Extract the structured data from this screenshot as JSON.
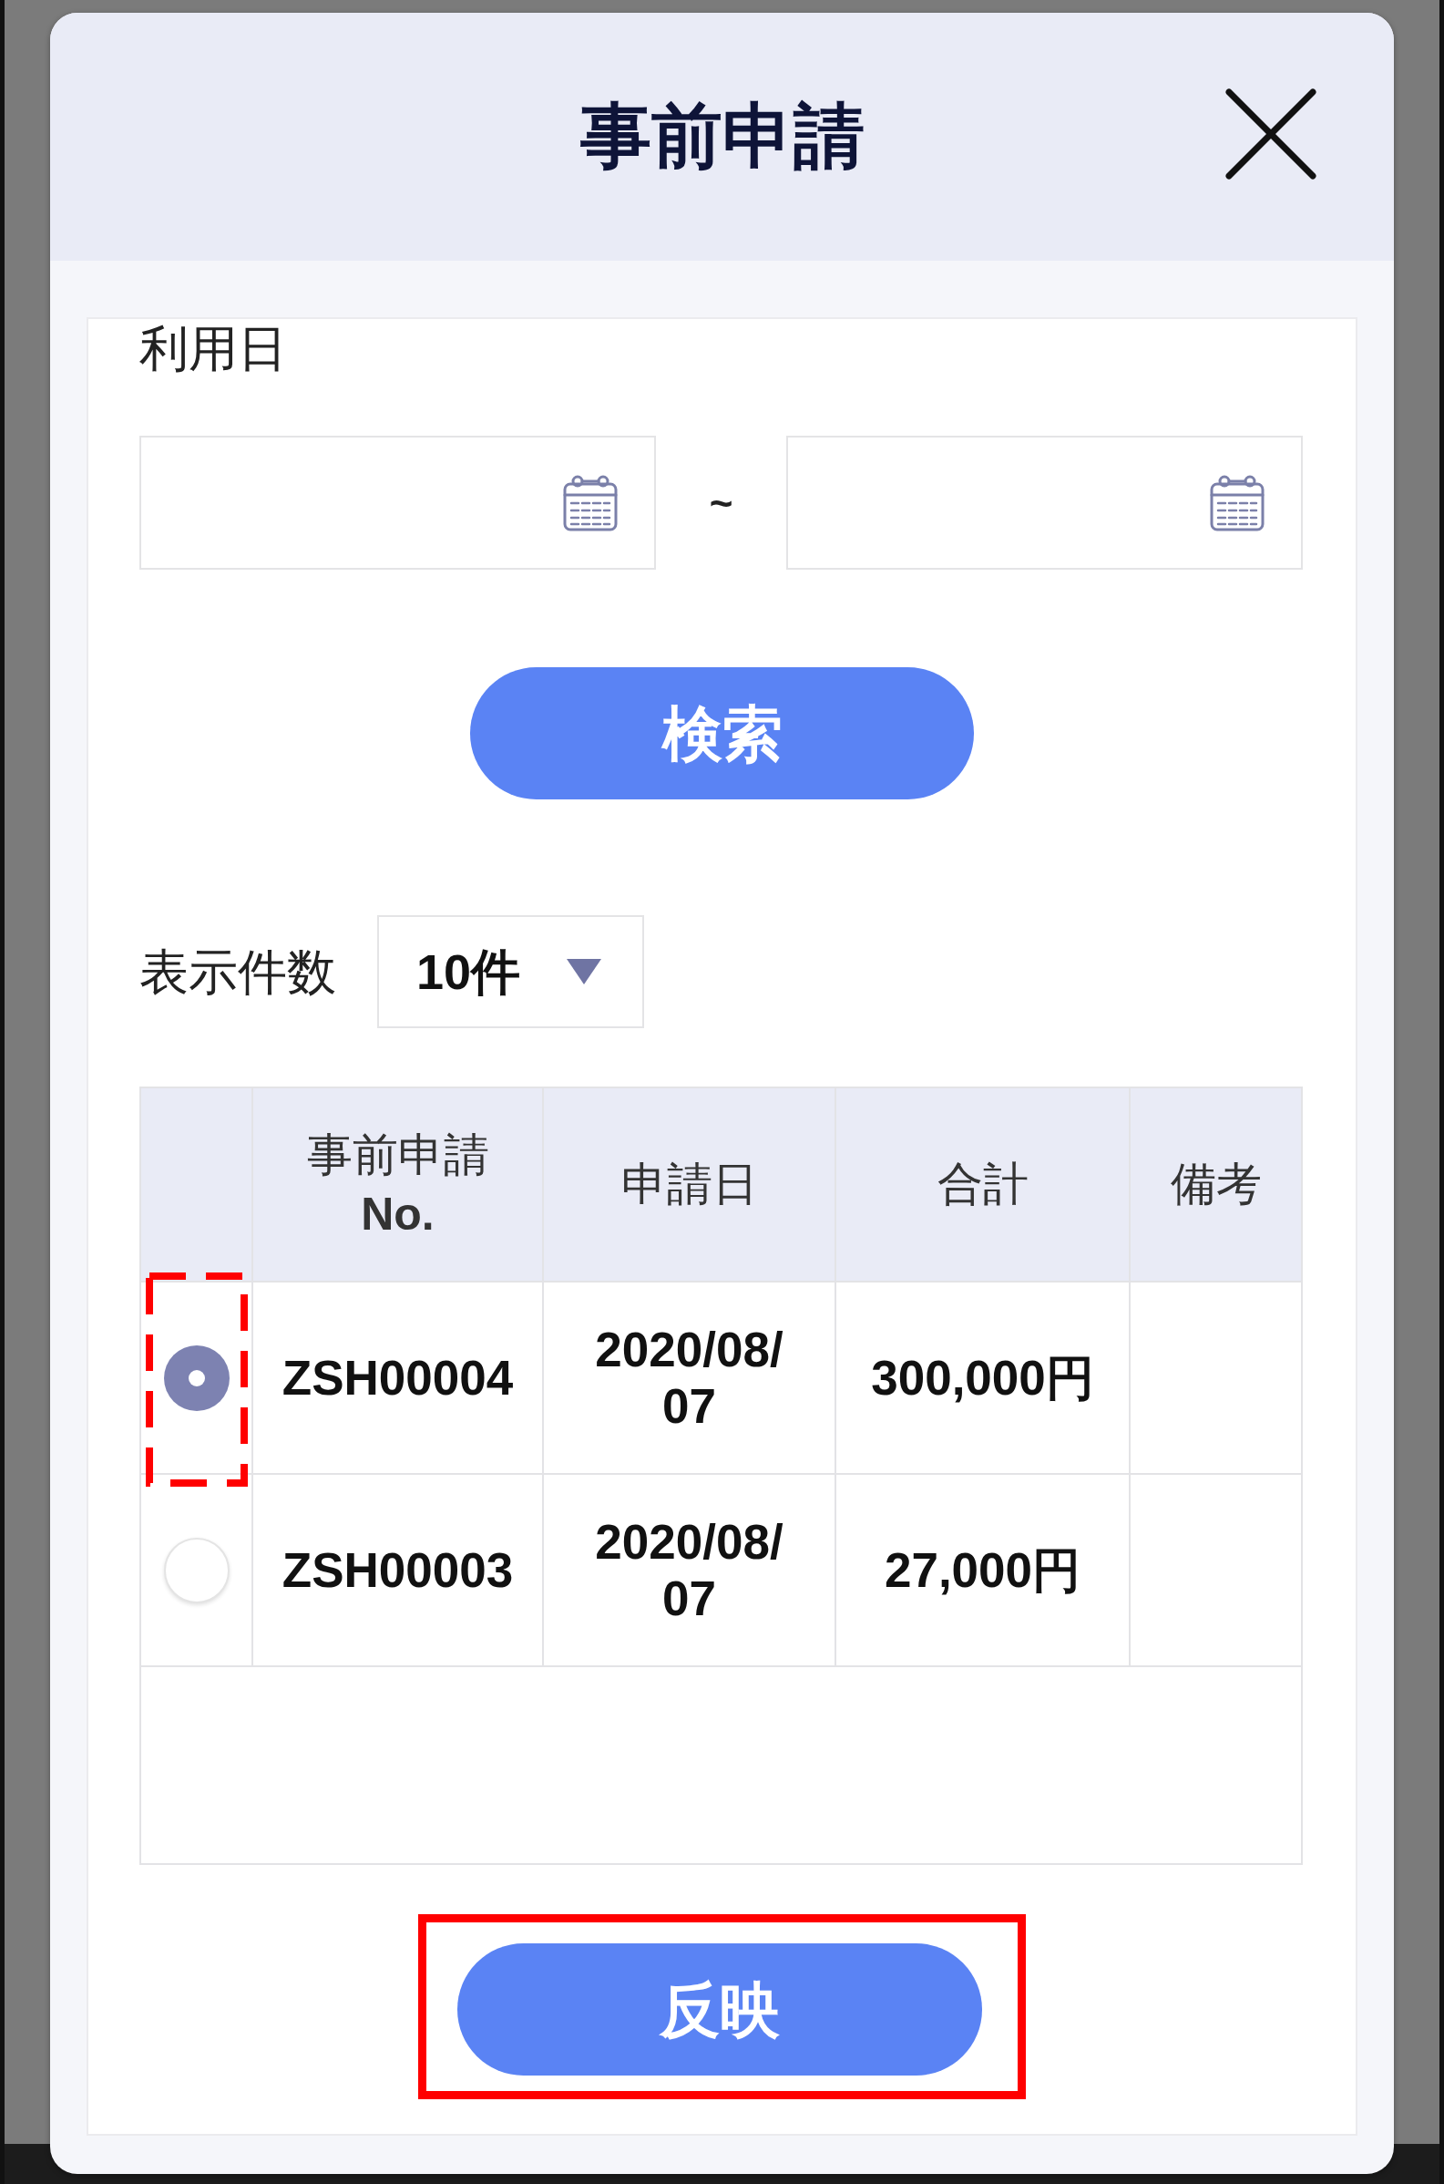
{
  "dialog": {
    "title": "事前申請"
  },
  "date_range": {
    "label": "利用日",
    "fields": [
      {
        "kind": "date"
      },
      {
        "kind": "date"
      }
    ],
    "separator": "~"
  },
  "search_button": {
    "label": "検索"
  },
  "page_size": {
    "label": "表示件数",
    "value": "10件"
  },
  "table": {
    "columns": [
      {
        "label": "事前申請 **No.**"
      },
      {
        "label": "申請日"
      },
      {
        "label": "合計"
      },
      {
        "label": "備考"
      }
    ],
    "rows": [
      {
        "selected": true,
        "highlighted": true,
        "cells": [
          "ZSH00004",
          "2020/08/07",
          "300,000円"
        ]
      },
      {
        "selected": false,
        "highlighted": false,
        "cells": [
          "ZSH00003",
          "2020/08/07",
          "27,000円"
        ]
      }
    ]
  },
  "reflect_button": {
    "label": "反映",
    "highlighted": true
  }
}
